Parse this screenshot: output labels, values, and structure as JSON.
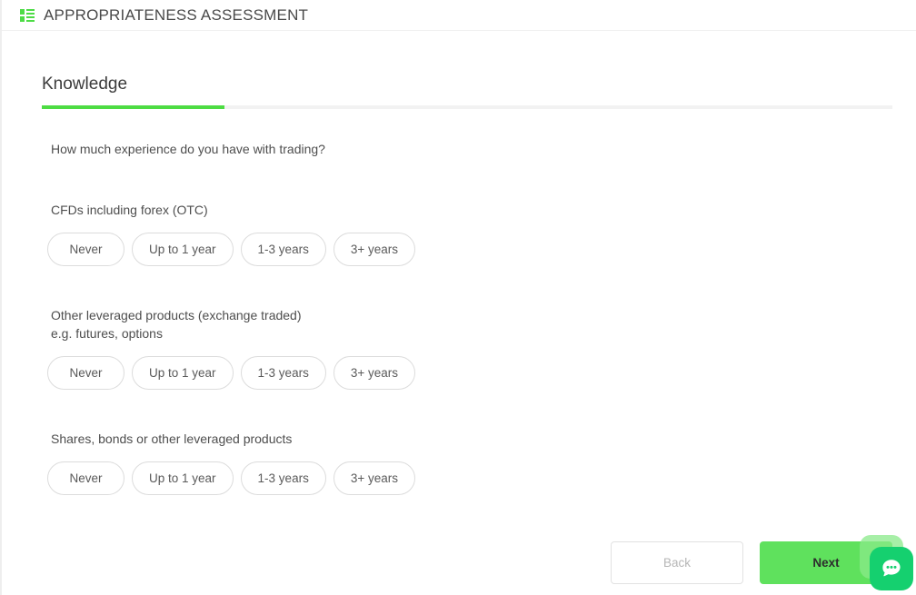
{
  "header": {
    "icon": "list-icon",
    "title": "APPROPRIATENESS ASSESSMENT"
  },
  "tabs": [
    {
      "label": "Knowledge",
      "active": true
    }
  ],
  "main": {
    "intro_question": "How much experience do you have with trading?",
    "questions": [
      {
        "label": "CFDs including forex (OTC)",
        "sublabel": "",
        "options": [
          "Never",
          "Up to 1 year",
          "1-3 years",
          "3+ years"
        ]
      },
      {
        "label": "Other leveraged products (exchange traded)",
        "sublabel": "e.g. futures, options",
        "options": [
          "Never",
          "Up to 1 year",
          "1-3 years",
          "3+ years"
        ]
      },
      {
        "label": "Shares, bonds or other leveraged products",
        "sublabel": "",
        "options": [
          "Never",
          "Up to 1 year",
          "1-3 years",
          "3+ years"
        ]
      }
    ]
  },
  "footer": {
    "back_label": "Back",
    "next_label": "Next"
  },
  "chat": {
    "icon": "chat-bubble-icon"
  },
  "colors": {
    "accent_green": "#4ddc43",
    "next_button_green": "#5fe15d",
    "chat_green": "#15d06f",
    "text_primary": "#4e4e4e",
    "border_gray": "#dcdcdc"
  }
}
